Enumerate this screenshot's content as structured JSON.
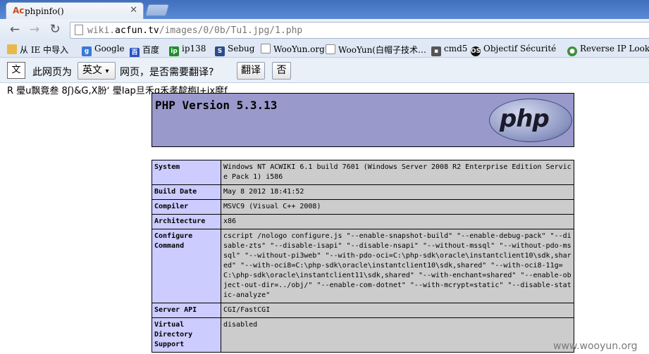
{
  "browser": {
    "tab": {
      "favicon": "Ac",
      "title": "phpinfo()"
    },
    "url_prefix": "wiki.",
    "url_domain": "acfun.tv",
    "url_path": "/images/0/0b/Tu1.jpg/1.php"
  },
  "bookmarks": [
    {
      "icon": "folder-icon",
      "glyph": "",
      "label": "从 IE 中导入"
    },
    {
      "icon": "google-icon",
      "glyph": "g",
      "label": "Google"
    },
    {
      "icon": "baidu-icon",
      "glyph": "百",
      "label": "百度"
    },
    {
      "icon": "ip138-icon",
      "glyph": "ip",
      "label": "ip138"
    },
    {
      "icon": "sebug-icon",
      "glyph": "S",
      "label": "Sebug"
    },
    {
      "icon": "page-icon",
      "glyph": "",
      "label": "WooYun.org"
    },
    {
      "icon": "page-icon",
      "glyph": "",
      "label": "WooYun(白帽子技术…"
    },
    {
      "icon": "cmd-icon",
      "glyph": "▪",
      "label": "cmd5"
    },
    {
      "icon": "os-icon",
      "glyph": "OS",
      "label": "Objectif Sécurité"
    },
    {
      "icon": "reverse-icon",
      "glyph": "●",
      "label": "Reverse IP Lookup"
    }
  ],
  "translate": {
    "icon_glyph": "文",
    "text_before": "此网页为",
    "language": "英文",
    "text_after": "网页，是否需要翻译?",
    "translate_button": "翻译",
    "no_button": "否"
  },
  "garbled_text": "R  璺u飘竟叁  8ʃ)&G,X朌ʻ  璺Ⅰap旦禾g禾孝靛栴I+jx靡f",
  "php": {
    "version": "PHP Version 5.3.13",
    "logo_text": "php",
    "rows": [
      {
        "key": "System",
        "value": "Windows NT ACWIKI 6.1 build 7601 (Windows Server 2008 R2 Enterprise Edition Service Pack 1) i586"
      },
      {
        "key": "Build Date",
        "value": "May 8 2012 18:41:52"
      },
      {
        "key": "Compiler",
        "value": "MSVC9 (Visual C++ 2008)"
      },
      {
        "key": "Architecture",
        "value": "x86"
      },
      {
        "key": "Configure Command",
        "value": "cscript /nologo configure.js \"--enable-snapshot-build\" \"--enable-debug-pack\" \"--disable-zts\" \"--disable-isapi\" \"--disable-nsapi\" \"--without-mssql\" \"--without-pdo-mssql\" \"--without-pi3web\" \"--with-pdo-oci=C:\\php-sdk\\oracle\\instantclient10\\sdk,shared\" \"--with-oci8=C:\\php-sdk\\oracle\\instantclient10\\sdk,shared\" \"--with-oci8-11g=C:\\php-sdk\\oracle\\instantclient11\\sdk,shared\" \"--with-enchant=shared\" \"--enable-object-out-dir=../obj/\" \"--enable-com-dotnet\" \"--with-mcrypt=static\" \"--disable-static-analyze\""
      },
      {
        "key": "Server API",
        "value": "CGI/FastCGI"
      },
      {
        "key": "Virtual Directory Support",
        "value": "disabled"
      }
    ]
  },
  "watermark": "www.wooyun.org"
}
